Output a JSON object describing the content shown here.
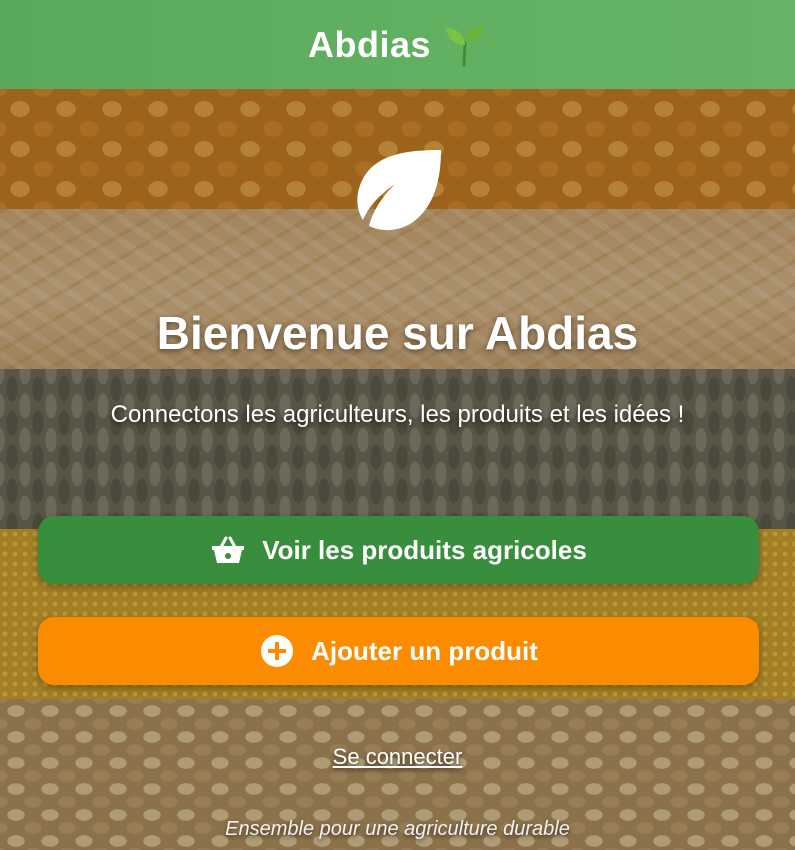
{
  "header": {
    "title": "Abdias",
    "icon": "sprout-icon"
  },
  "hero": {
    "logo_icon": "leaf-icon",
    "title": "Bienvenue sur Abdias",
    "subtitle": "Connectons les agriculteurs, les produits et les idées !"
  },
  "actions": {
    "view_products": {
      "label": "Voir les produits agricoles",
      "icon": "basket-icon",
      "color": "#388e3c"
    },
    "add_product": {
      "label": "Ajouter un produit",
      "icon": "plus-circle-icon",
      "color": "#fb8c00"
    }
  },
  "login": {
    "label": "Se connecter"
  },
  "footer": {
    "tagline": "Ensemble pour une agriculture durable"
  },
  "colors": {
    "header": "#5aa95a",
    "primary_button": "#388e3c",
    "secondary_button": "#fb8c00"
  }
}
